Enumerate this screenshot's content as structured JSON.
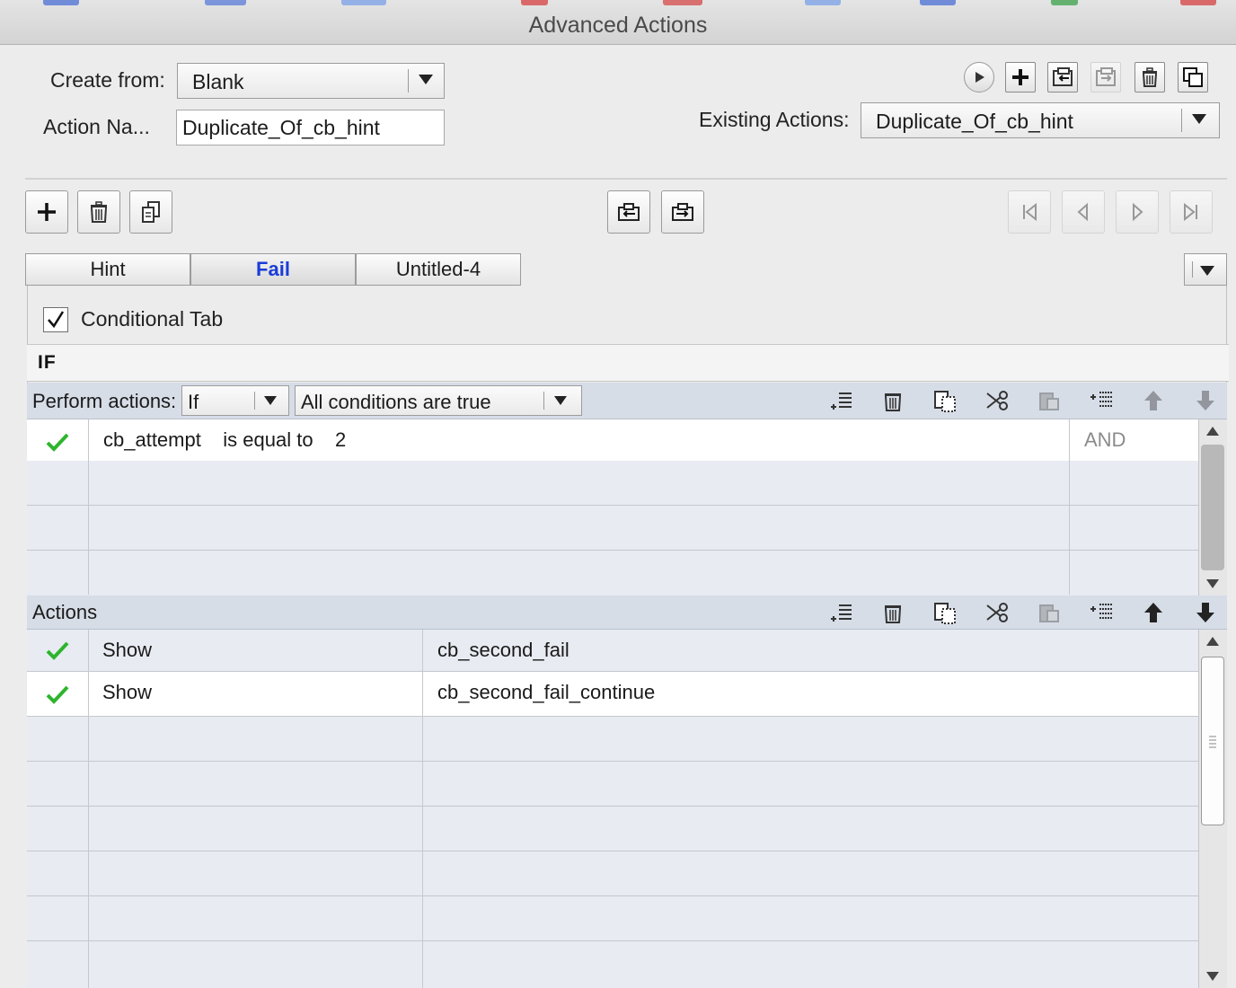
{
  "window": {
    "title": "Advanced Actions"
  },
  "form": {
    "create_from_label": "Create from:",
    "create_from_value": "Blank",
    "action_name_label": "Action Na...",
    "action_name_value": "Duplicate_Of_cb_hint",
    "existing_actions_label": "Existing Actions:",
    "existing_actions_value": "Duplicate_Of_cb_hint"
  },
  "tabs": [
    {
      "label": "Hint",
      "active": false
    },
    {
      "label": "Fail",
      "active": true
    },
    {
      "label": "Untitled-4",
      "active": false
    }
  ],
  "conditional": {
    "label": "Conditional Tab",
    "checked": true
  },
  "if_section": {
    "label": "IF",
    "perform_label": "Perform actions:",
    "perform_value": "If",
    "conditions_value": "All conditions are true",
    "conditions": [
      {
        "variable": "cb_attempt",
        "operator": "is equal to",
        "value": "2",
        "joiner": "AND"
      }
    ]
  },
  "actions_section": {
    "label": "Actions",
    "rows": [
      {
        "action": "Show",
        "target": "cb_second_fail"
      },
      {
        "action": "Show",
        "target": "cb_second_fail_continue"
      }
    ]
  },
  "colors": {
    "active_tab": "#1a3dd8",
    "section_bar": "#d6dde7",
    "check": "#2db52d"
  }
}
